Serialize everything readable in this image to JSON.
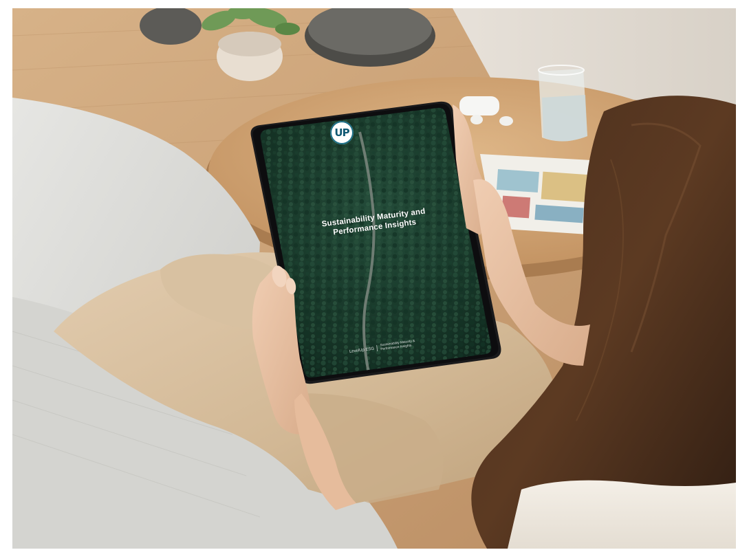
{
  "scene": {
    "description_icons": [
      "tablet-device",
      "forest-road-cover"
    ]
  },
  "tablet": {
    "logo_text": "UP",
    "title_line1": "Sustainability Maturity and",
    "title_line2": "Performance Insights",
    "footer_brand": "LevelUp ESG",
    "footer_sub_line1": "Sustainability Maturity &",
    "footer_sub_line2": "Performance Insights"
  },
  "colors": {
    "logo_ring": "#1c6f87",
    "forest_dark": "#0f2a20",
    "forest_mid": "#1f4634",
    "floor": "#c99f74",
    "sofa": "#d8d8d6"
  }
}
